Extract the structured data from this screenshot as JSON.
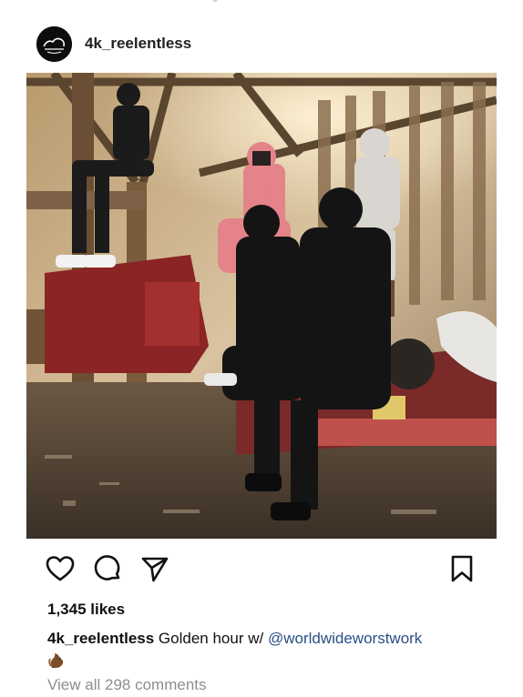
{
  "post": {
    "username": "4k_reelentless",
    "avatar_icon": "reelentless-logo-avatar",
    "image_alt_name": "group-photo-in-barn",
    "actions": {
      "like_icon": "heart-icon",
      "comment_icon": "comment-bubble-icon",
      "share_icon": "paper-plane-icon",
      "save_icon": "bookmark-icon"
    },
    "likes_text": "1,345 likes",
    "caption": {
      "user": "4k_reelentless",
      "text": " Golden hour w/ ",
      "mention": "@worldwideworstwork",
      "emoji_icon": "squirrel-emoji"
    },
    "view_comments": "View all 298 comments"
  },
  "colors": {
    "mention": "#2b4e86",
    "muted": "#8e8e8e",
    "text": "#111111"
  }
}
